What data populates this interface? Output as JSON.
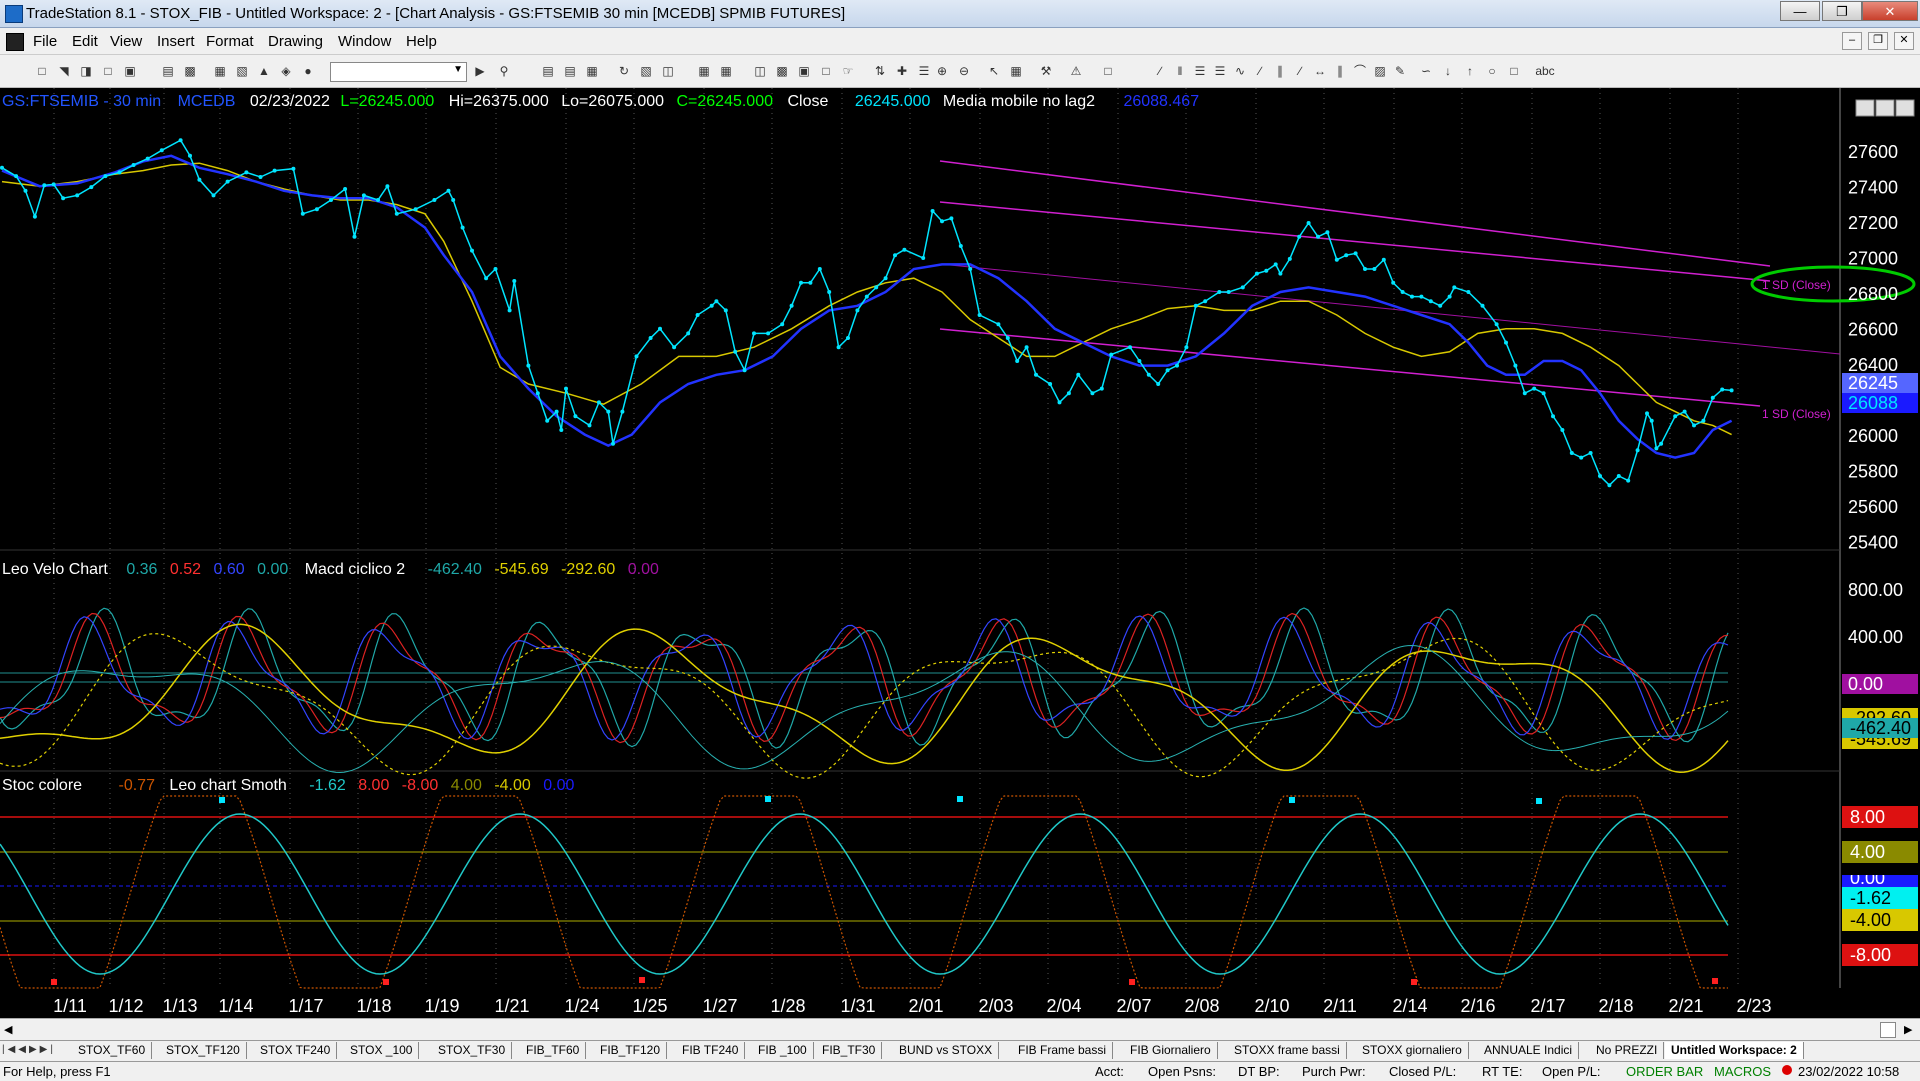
{
  "window": {
    "title": "TradeStation 8.1 - STOX_FIB - Untitled Workspace:  2 - [Chart Analysis - GS:FTSEMIB  30 min  [MCEDB] SPMIB FUTURES]"
  },
  "menu": [
    "File",
    "Edit",
    "View",
    "Insert",
    "Format",
    "Drawing",
    "Window",
    "Help"
  ],
  "price_header": {
    "symbol": "GS:FTSEMIB - 30 min",
    "feed": "MCEDB",
    "date": "02/23/2022",
    "last": "L=26245.000",
    "high": "Hi=26375.000",
    "low": "Lo=26075.000",
    "close": "C=26245.000",
    "close_label": "Close",
    "close_value": "26245.000",
    "ma_label": "Media mobile no lag2",
    "ma_value": "26088.467"
  },
  "price_axis": [
    "27600",
    "27400",
    "27200",
    "27000",
    "26800",
    "26600",
    "26400",
    "26200",
    "26000",
    "25800",
    "25600",
    "25400"
  ],
  "price_markers": {
    "last": "26245",
    "ma": "26088"
  },
  "channel_labels": [
    "1 SD (Close)",
    "1 SD (Close)"
  ],
  "osc1_header": {
    "name": "Leo Velo Chart",
    "v1": "0.36",
    "v2": "0.52",
    "v3": "0.60",
    "v4": "0.00",
    "name2": "Macd ciclico 2",
    "v5": "-462.40",
    "v6": "-545.69",
    "v7": "-292.60",
    "v8": "0.00"
  },
  "osc1_axis": [
    "800.00",
    "400.00"
  ],
  "osc1_markers": [
    "0.00",
    "-292.60",
    "-462.40",
    "-545.69"
  ],
  "osc2_header": {
    "name": "Stoc colore",
    "v1": "-0.77",
    "name2": "Leo chart Smoth",
    "v2": "-1.62",
    "v3": "8.00",
    "v4": "-8.00",
    "v5": "4.00",
    "v6": "-4.00",
    "v7": "0.00"
  },
  "osc2_markers": [
    "8.00",
    "4.00",
    "0.00",
    "-1.62",
    "-4.00",
    "-8.00"
  ],
  "x_axis": [
    "1/11",
    "1/12",
    "1/13",
    "1/14",
    "1/17",
    "1/18",
    "1/19",
    "1/21",
    "1/24",
    "1/25",
    "1/27",
    "1/28",
    "1/31",
    "2/01",
    "2/03",
    "2/04",
    "2/07",
    "2/08",
    "2/10",
    "2/11",
    "2/14",
    "2/16",
    "2/17",
    "2/18",
    "2/21",
    "2/23"
  ],
  "tabs": [
    "STOX_TF60",
    "STOX_TF120",
    "STOX TF240",
    "STOX _100",
    "STOX_TF30",
    "FIB_TF60",
    "FIB_TF120",
    "FIB TF240",
    "FIB _100",
    "FIB_TF30",
    "BUND vs STOXX",
    "FIB Frame bassi",
    "FIB Giornaliero",
    "STOXX frame bassi",
    "STOXX giornaliero",
    "ANNUALE Indici",
    "No PREZZI",
    "Untitled Workspace:  2"
  ],
  "status": {
    "help": "For Help, press F1",
    "acct": "Acct:",
    "open_psns": "Open Psns:",
    "dt_bp": "DT BP:",
    "purch_pwr": "Purch Pwr:",
    "closed_pl": "Closed P/L:",
    "rt_te": "RT TE:",
    "open_pl": "Open P/L:",
    "order_bar": "ORDER BAR",
    "macros": "MACROS",
    "datetime": "23/02/2022 10:58"
  },
  "colors": {
    "price": "#00e5ff",
    "ma_blue": "#1a1aff",
    "ma_yellow": "#d8c800",
    "channel": "#d020d0",
    "highlight": "#00cc00"
  }
}
